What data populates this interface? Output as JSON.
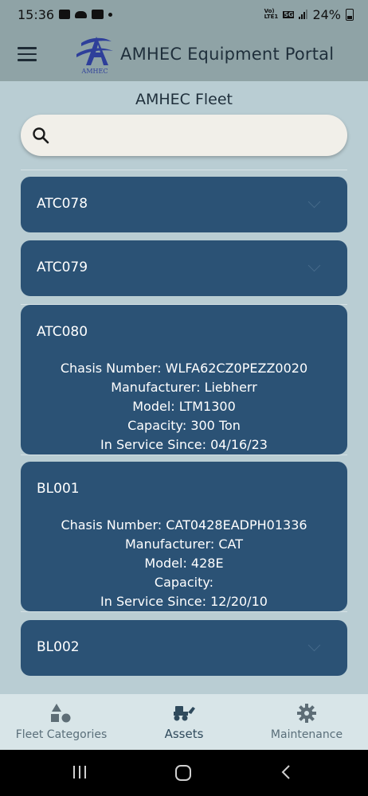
{
  "status_bar": {
    "time": "15:36",
    "network_label": "5G",
    "battery": "24%"
  },
  "header": {
    "title": "AMHEC Equipment Portal",
    "logo_text": "AMHEC"
  },
  "page": {
    "title": "AMHEC Fleet"
  },
  "search": {
    "placeholder": "",
    "value": ""
  },
  "equipment": [
    {
      "id": "ATC078",
      "expanded": false
    },
    {
      "id": "ATC079",
      "expanded": false
    },
    {
      "id": "ATC080",
      "expanded": true,
      "chasis": "Chasis Number: WLFA62CZ0PEZZ0020",
      "manufacturer": "Manufacturer: Liebherr",
      "model": "Model: LTM1300",
      "capacity": "Capacity: 300 Ton",
      "in_service": "In Service Since: 04/16/23"
    },
    {
      "id": "BL001",
      "expanded": true,
      "chasis": "Chasis Number: CAT0428EADPH01336",
      "manufacturer": "Manufacturer: CAT",
      "model": "Model: 428E",
      "capacity": "Capacity:",
      "in_service": "In Service Since: 12/20/10"
    },
    {
      "id": "BL002",
      "expanded": false
    }
  ],
  "bottom_nav": [
    {
      "label": "Fleet Categories",
      "icon": "shapes-icon",
      "active": false
    },
    {
      "label": "Assets",
      "icon": "loader-vehicle-icon",
      "active": true
    },
    {
      "label": "Maintenance",
      "icon": "gear-icon",
      "active": false
    }
  ],
  "colors": {
    "card": "#2b5275",
    "header": "#8fa3a6",
    "background": "#b9cdd3"
  }
}
